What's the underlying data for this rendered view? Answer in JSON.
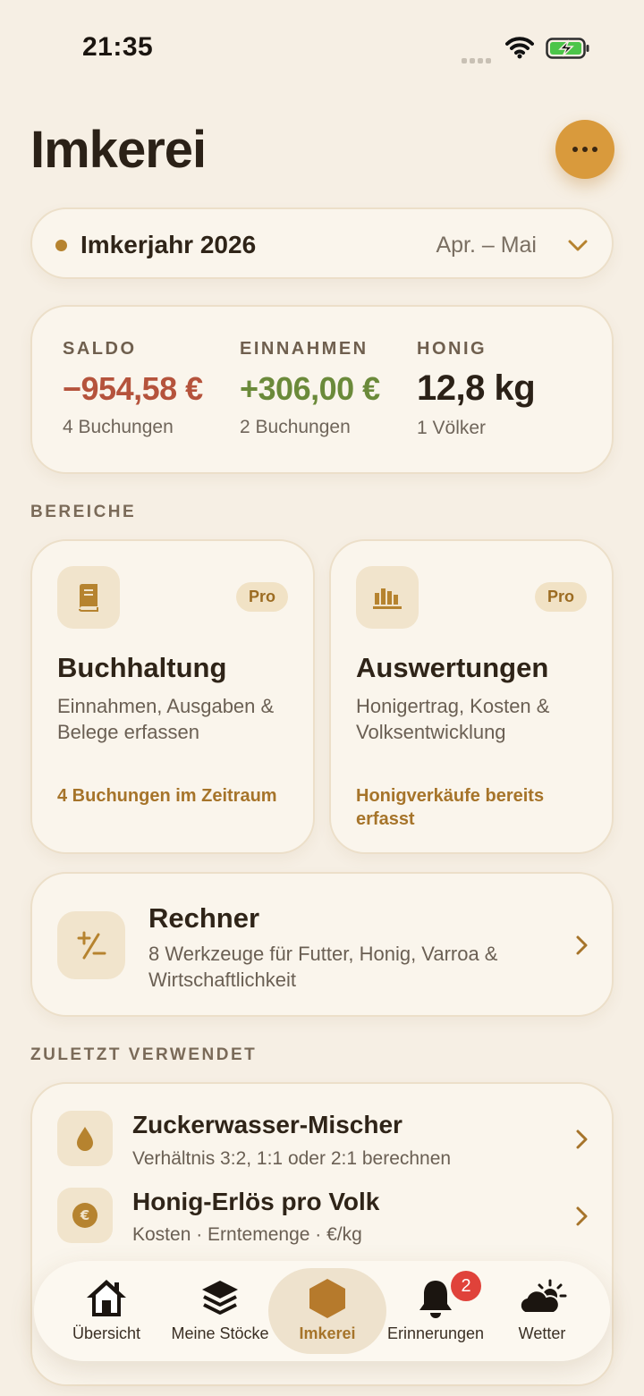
{
  "status": {
    "time": "21:35"
  },
  "header": {
    "title": "Imkerei"
  },
  "year_selector": {
    "label": "Imkerjahr 2026",
    "range": "Apr. – Mai"
  },
  "stats": [
    {
      "label": "SALDO",
      "value": "−954,58 €",
      "sub": "4 Buchungen",
      "color": "#b5533c"
    },
    {
      "label": "EINNAHMEN",
      "value": "+306,00 €",
      "sub": "2 Buchungen",
      "color": "#6b8a3a"
    },
    {
      "label": "HONIG",
      "value": "12,8 kg",
      "sub": "1 Völker",
      "color": "#2b2117"
    }
  ],
  "sections": {
    "areas": "BEREICHE",
    "recent": "ZULETZT VERWENDET"
  },
  "tiles": [
    {
      "badge": "Pro",
      "title": "Buchhaltung",
      "desc": "Einnahmen, Ausgaben & Belege erfassen",
      "foot": "4 Buchungen im Zeitraum",
      "icon": "book-icon"
    },
    {
      "badge": "Pro",
      "title": "Auswertungen",
      "desc": "Honigertrag, Kosten & Volksentwicklung",
      "foot": "Honigverkäufe bereits erfasst",
      "icon": "bar-chart-icon"
    }
  ],
  "rechner": {
    "title": "Rechner",
    "desc": "8 Werkzeuge für Futter, Honig, Varroa & Wirtschaftlichkeit",
    "icon": "plus-minus-icon"
  },
  "recent": [
    {
      "title": "Zuckerwasser-Mischer",
      "sub": "Verhältnis 3:2, 1:1 oder 2:1 berechnen",
      "icon": "drop-icon"
    },
    {
      "title": "Honig-Erlös pro Volk",
      "sub": "Kosten · Erntemenge · €/kg",
      "icon": "euro-coin-icon"
    }
  ],
  "tabs": [
    {
      "label": "Übersicht",
      "icon": "home-icon"
    },
    {
      "label": "Meine Stöcke",
      "icon": "layers-icon"
    },
    {
      "label": "Imkerei",
      "icon": "hexagon-icon",
      "active": true
    },
    {
      "label": "Erinnerungen",
      "icon": "bell-icon",
      "badge": "2"
    },
    {
      "label": "Wetter",
      "icon": "sun-cloud-icon"
    }
  ],
  "colors": {
    "accent": "#b6832f",
    "background": "#f6efe4",
    "card": "#faf5ec"
  }
}
